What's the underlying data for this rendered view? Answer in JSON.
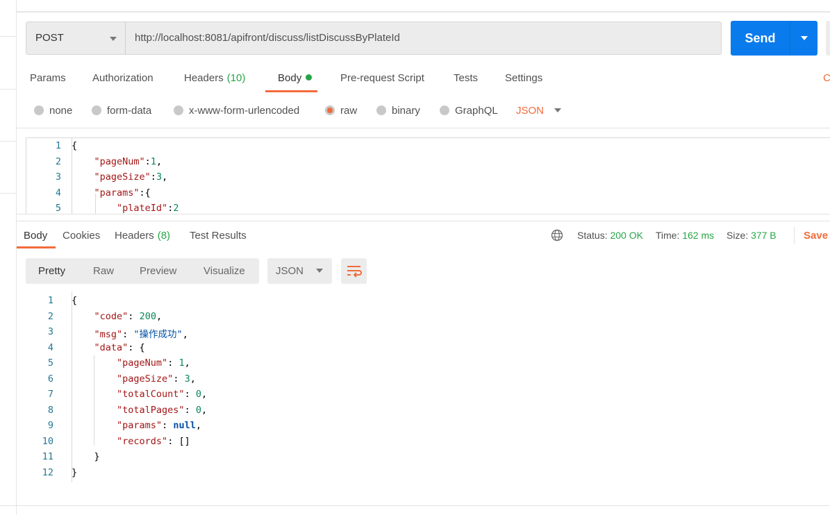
{
  "request": {
    "method": "POST",
    "url": "http://localhost:8081/apifront/discuss/listDiscussByPlateId",
    "send_label": "Send"
  },
  "request_tabs": [
    {
      "label": "Params"
    },
    {
      "label": "Authorization"
    },
    {
      "label": "Headers",
      "count": "(10)"
    },
    {
      "label": "Body",
      "active": true
    },
    {
      "label": "Pre-request Script"
    },
    {
      "label": "Tests"
    },
    {
      "label": "Settings"
    }
  ],
  "cookies_cut": "C",
  "body_types": [
    {
      "label": "none"
    },
    {
      "label": "form-data"
    },
    {
      "label": "x-www-form-urlencoded"
    },
    {
      "label": "raw",
      "selected": true
    },
    {
      "label": "binary"
    },
    {
      "label": "GraphQL"
    }
  ],
  "raw_format": "JSON",
  "request_body": [
    [
      {
        "t": "{",
        "c": "p"
      }
    ],
    [
      {
        "t": "    "
      },
      {
        "t": "\"pageNum\"",
        "c": "k"
      },
      {
        "t": ":",
        "c": "p"
      },
      {
        "t": "1",
        "c": "n"
      },
      {
        "t": ",",
        "c": "p"
      }
    ],
    [
      {
        "t": "    "
      },
      {
        "t": "\"pageSize\"",
        "c": "k"
      },
      {
        "t": ":",
        "c": "p"
      },
      {
        "t": "3",
        "c": "n"
      },
      {
        "t": ",",
        "c": "p"
      }
    ],
    [
      {
        "t": "    "
      },
      {
        "t": "\"params\"",
        "c": "k"
      },
      {
        "t": ":{",
        "c": "p"
      }
    ],
    [
      {
        "t": "        "
      },
      {
        "t": "\"plateId\"",
        "c": "k"
      },
      {
        "t": ":",
        "c": "p"
      },
      {
        "t": "2",
        "c": "n"
      }
    ]
  ],
  "response_tabs": [
    {
      "label": "Body",
      "active": true
    },
    {
      "label": "Cookies"
    },
    {
      "label": "Headers",
      "count": "(8)"
    },
    {
      "label": "Test Results"
    }
  ],
  "status": {
    "status_label": "Status:",
    "status": "200 OK",
    "time_label": "Time:",
    "time": "162 ms",
    "size_label": "Size:",
    "size": "377 B",
    "save": "Save"
  },
  "view_modes": [
    "Pretty",
    "Raw",
    "Preview",
    "Visualize"
  ],
  "response_format": "JSON",
  "response_body": [
    [
      {
        "t": "{",
        "c": "p"
      }
    ],
    [
      {
        "t": "    "
      },
      {
        "t": "\"code\"",
        "c": "k"
      },
      {
        "t": ": ",
        "c": "p"
      },
      {
        "t": "200",
        "c": "n"
      },
      {
        "t": ",",
        "c": "p"
      }
    ],
    [
      {
        "t": "    "
      },
      {
        "t": "\"msg\"",
        "c": "k"
      },
      {
        "t": ": ",
        "c": "p"
      },
      {
        "t": "\"操作成功\"",
        "c": "s"
      },
      {
        "t": ",",
        "c": "p"
      }
    ],
    [
      {
        "t": "    "
      },
      {
        "t": "\"data\"",
        "c": "k"
      },
      {
        "t": ": {",
        "c": "p"
      }
    ],
    [
      {
        "t": "        "
      },
      {
        "t": "\"pageNum\"",
        "c": "k"
      },
      {
        "t": ": ",
        "c": "p"
      },
      {
        "t": "1",
        "c": "n"
      },
      {
        "t": ",",
        "c": "p"
      }
    ],
    [
      {
        "t": "        "
      },
      {
        "t": "\"pageSize\"",
        "c": "k"
      },
      {
        "t": ": ",
        "c": "p"
      },
      {
        "t": "3",
        "c": "n"
      },
      {
        "t": ",",
        "c": "p"
      }
    ],
    [
      {
        "t": "        "
      },
      {
        "t": "\"totalCount\"",
        "c": "k"
      },
      {
        "t": ": ",
        "c": "p"
      },
      {
        "t": "0",
        "c": "n"
      },
      {
        "t": ",",
        "c": "p"
      }
    ],
    [
      {
        "t": "        "
      },
      {
        "t": "\"totalPages\"",
        "c": "k"
      },
      {
        "t": ": ",
        "c": "p"
      },
      {
        "t": "0",
        "c": "n"
      },
      {
        "t": ",",
        "c": "p"
      }
    ],
    [
      {
        "t": "        "
      },
      {
        "t": "\"params\"",
        "c": "k"
      },
      {
        "t": ": ",
        "c": "p"
      },
      {
        "t": "null",
        "c": "nl"
      },
      {
        "t": ",",
        "c": "p"
      }
    ],
    [
      {
        "t": "        "
      },
      {
        "t": "\"records\"",
        "c": "k"
      },
      {
        "t": ": ",
        "c": "p"
      },
      {
        "t": "[]",
        "c": "p"
      }
    ],
    [
      {
        "t": "    "
      },
      {
        "t": "}",
        "c": "p"
      }
    ],
    [
      {
        "t": "}",
        "c": "p"
      }
    ]
  ],
  "colors": {
    "accent": "#f26b3a",
    "send": "#097bed",
    "success": "#26a547"
  }
}
